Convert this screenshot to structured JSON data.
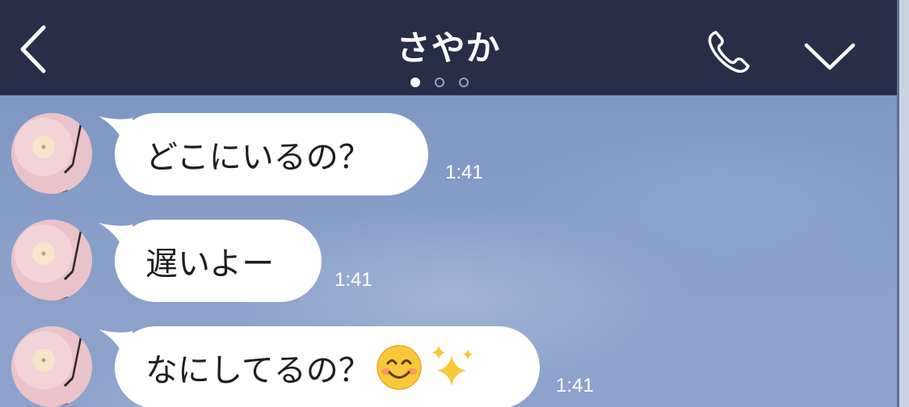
{
  "header": {
    "title": "さやか",
    "back_icon": "chevron-left-icon",
    "call_icon": "phone-icon",
    "menu_icon": "chevron-down-icon",
    "page_indicator": {
      "count": 3,
      "active_index": 0
    },
    "background_color": "#262f47"
  },
  "chat": {
    "background_color": "#8aa0c9",
    "messages": [
      {
        "text": "どこにいるの？",
        "time": "1:41",
        "emojis": []
      },
      {
        "text": "遅いよー",
        "time": "1:41",
        "emojis": []
      },
      {
        "text": "なにしてるの？",
        "time": "1:41",
        "emojis": [
          "smiling-face-emoji",
          "sparkles-emoji"
        ]
      }
    ]
  }
}
